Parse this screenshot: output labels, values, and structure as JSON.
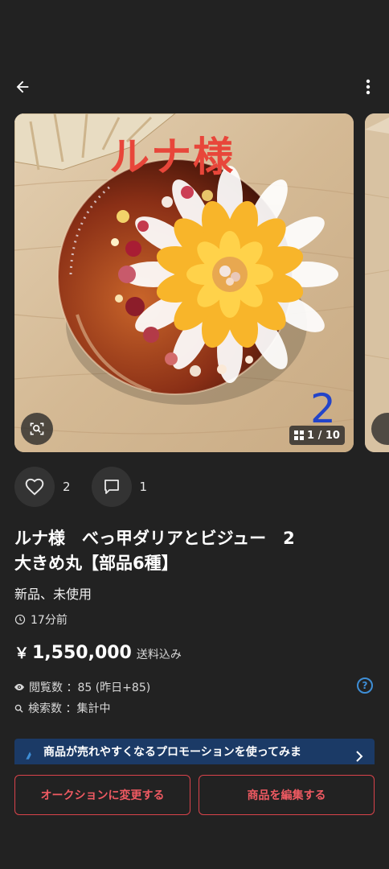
{
  "photo": {
    "overlay_text": "ルナ様",
    "overlay_number": "2",
    "counter": "1 / 10"
  },
  "actions": {
    "likes": "2",
    "comments": "1"
  },
  "item": {
    "title": "ルナ様　べっ甲ダリアとビジュー　2\n大きめ丸【部品6種】",
    "condition": "新品、未使用",
    "posted": "17分前",
    "price_symbol": "￥",
    "price": "1,550,000",
    "shipping": "送料込み"
  },
  "stats": {
    "views": "閲覧数 ：85 (昨日+85)",
    "searches": "検索数 ：集計中",
    "help": "?"
  },
  "promo": {
    "text": "商品が売れやすくなるプロモーションを使ってみま"
  },
  "buttons": {
    "auction": "オークションに変更する",
    "edit": "商品を編集する"
  },
  "colors": {
    "accent_red": "#ef5a62",
    "promo_bg": "#1b3a66",
    "help_blue": "#3e8ed6"
  }
}
